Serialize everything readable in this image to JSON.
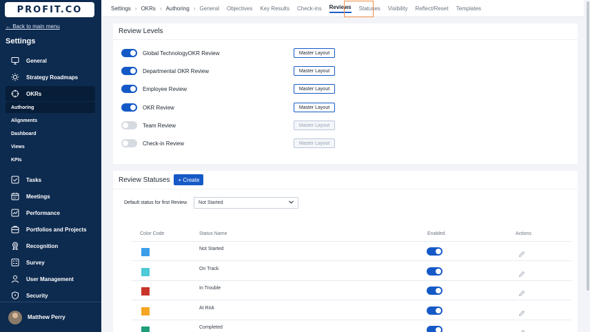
{
  "sidebar": {
    "logo": "PROFIT.CO",
    "back_link": "← Back to main menu",
    "title": "Settings",
    "items_top": [
      {
        "label": "General",
        "icon": "monitor-icon"
      },
      {
        "label": "Strategy Roadmaps",
        "icon": "bulb-icon"
      },
      {
        "label": "OKRs",
        "icon": "target-icon"
      }
    ],
    "okr_sub": [
      "Authoring",
      "Alignments",
      "Dashboard",
      "Views",
      "KPIs"
    ],
    "items_bottom": [
      {
        "label": "Tasks",
        "icon": "checkbox-icon"
      },
      {
        "label": "Meetings",
        "icon": "calendar-icon"
      },
      {
        "label": "Performance",
        "icon": "chart-icon"
      },
      {
        "label": "Portfolios and Projects",
        "icon": "briefcase-icon"
      },
      {
        "label": "Recognition",
        "icon": "award-icon"
      },
      {
        "label": "Survey",
        "icon": "survey-icon"
      },
      {
        "label": "User Management",
        "icon": "user-icon"
      },
      {
        "label": "Security",
        "icon": "shield-icon"
      }
    ],
    "user": "Matthew Perry"
  },
  "topbar": {
    "crumbs": [
      "Settings",
      "OKRs",
      "Authoring"
    ],
    "tabs": [
      "General",
      "Objectives",
      "Key Results",
      "Check-ins",
      "Reviews",
      "Statuses",
      "Visibility",
      "Reflect/Reset",
      "Templates"
    ],
    "active_tab": "Reviews"
  },
  "review_levels": {
    "title": "Review Levels",
    "button_label": "Master Layout",
    "items": [
      {
        "label": "Global TechnologyOKR Review",
        "enabled": true
      },
      {
        "label": "Departmental OKR Review",
        "enabled": true
      },
      {
        "label": "Employee Review",
        "enabled": true
      },
      {
        "label": "OKR Review",
        "enabled": true
      },
      {
        "label": "Team Review",
        "enabled": false
      },
      {
        "label": "Check-in Review",
        "enabled": false
      }
    ]
  },
  "review_statuses": {
    "title": "Review Statuses",
    "create_label": "+ Create",
    "default_label": "Default status for first Review",
    "default_value": "Not Started",
    "columns": [
      "Color Code",
      "Status Name",
      "Enabled",
      "Actions"
    ],
    "rows": [
      {
        "name": "Not Started",
        "color": "#3b9ee8",
        "enabled": true
      },
      {
        "name": "On Track",
        "color": "#4ec9d6",
        "enabled": true
      },
      {
        "name": "In Trouble",
        "color": "#c9352b",
        "enabled": true
      },
      {
        "name": "At Risk",
        "color": "#f5a623",
        "enabled": true
      },
      {
        "name": "Completed",
        "color": "#1f9e7a",
        "enabled": true
      }
    ]
  }
}
